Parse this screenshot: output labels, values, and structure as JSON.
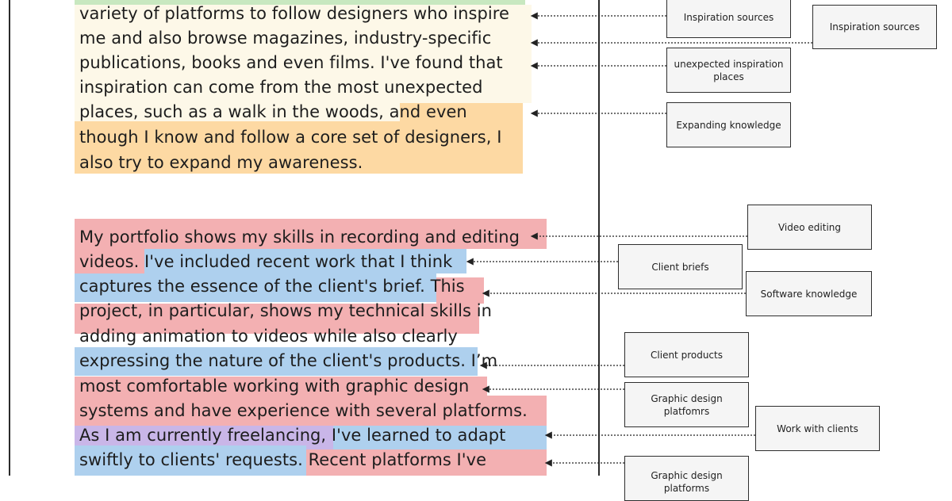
{
  "paragraph_1": {
    "lines": [
      "variety of platforms to follow designers who inspire",
      "me and also browse magazines, industry-specific",
      "publications, books and even films. I've found that",
      "inspiration can come from the most unexpected",
      "places, such as a walk in the woods, and even",
      "though I know and follow a core set of designers, I",
      "also try to expand my awareness."
    ]
  },
  "paragraph_2": {
    "lines": [
      "My portfolio shows my skills in recording and editing",
      "videos. I've included recent work that I think",
      "captures the essence of the client's brief. This",
      "project, in particular, shows my technical skills in",
      "adding animation to videos while also clearly",
      "expressing the nature of the client's products. I’m",
      "most comfortable working with graphic design",
      "systems and have experience with several platforms.",
      "As I am currently freelancing, I've learned to adapt",
      "swiftly to clients' requests. Recent platforms I've"
    ]
  },
  "annotations": [
    "Inspiration sources",
    "Inspiration sources",
    "unexpected inspiration places",
    "Expanding knowledge",
    "Video editing",
    "Client briefs",
    "Software knowledge",
    "Client products",
    "Graphic design platfomrs",
    "Work with clients",
    "Graphic design platforms"
  ],
  "colors": {
    "cream": "#fdf8e8",
    "orange": "#fdd9a3",
    "green": "#c8e8c0",
    "pink": "#f3b0b2",
    "blue": "#aed0ee",
    "lavender": "#c9b6e8",
    "line": "#2b2b2b"
  }
}
